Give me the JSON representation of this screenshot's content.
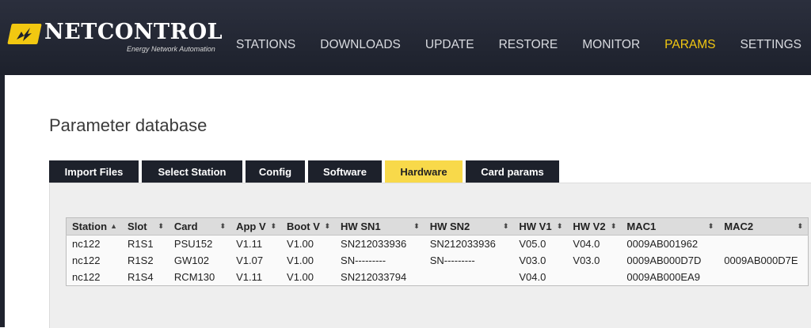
{
  "brand": {
    "name": "NETCONTROL",
    "tagline": "Energy Network Automation",
    "accent": "#f2c811"
  },
  "nav": [
    {
      "label": "STATIONS",
      "active": false
    },
    {
      "label": "DOWNLOADS",
      "active": false
    },
    {
      "label": "UPDATE",
      "active": false
    },
    {
      "label": "RESTORE",
      "active": false
    },
    {
      "label": "MONITOR",
      "active": false
    },
    {
      "label": "PARAMS",
      "active": true
    },
    {
      "label": "SETTINGS",
      "active": false
    }
  ],
  "page": {
    "title": "Parameter database"
  },
  "tabs": [
    {
      "label": "Import Files",
      "active": false
    },
    {
      "label": "Select Station",
      "active": false
    },
    {
      "label": "Config",
      "active": false
    },
    {
      "label": "Software",
      "active": false
    },
    {
      "label": "Hardware",
      "active": true
    },
    {
      "label": "Card params",
      "active": false
    }
  ],
  "table": {
    "columns": [
      "Station",
      "Slot",
      "Card",
      "App V",
      "Boot V",
      "HW SN1",
      "HW SN2",
      "HW V1",
      "HW V2",
      "MAC1",
      "MAC2"
    ],
    "sort_icons": [
      "sort-asc-icon",
      "sort-both-icon"
    ],
    "rows": [
      [
        "nc122",
        "R1S1",
        "PSU152",
        "V1.11",
        "V1.00",
        "SN212033936",
        "SN212033936",
        "V05.0",
        "V04.0",
        "0009AB001962",
        ""
      ],
      [
        "nc122",
        "R1S2",
        "GW102",
        "V1.07",
        "V1.00",
        "SN---------",
        "SN---------",
        "V03.0",
        "V03.0",
        "0009AB000D7D",
        "0009AB000D7E"
      ],
      [
        "nc122",
        "R1S4",
        "RCM130",
        "V1.11",
        "V1.00",
        "SN212033794",
        "",
        "V04.0",
        "",
        "0009AB000EA9",
        ""
      ]
    ]
  }
}
